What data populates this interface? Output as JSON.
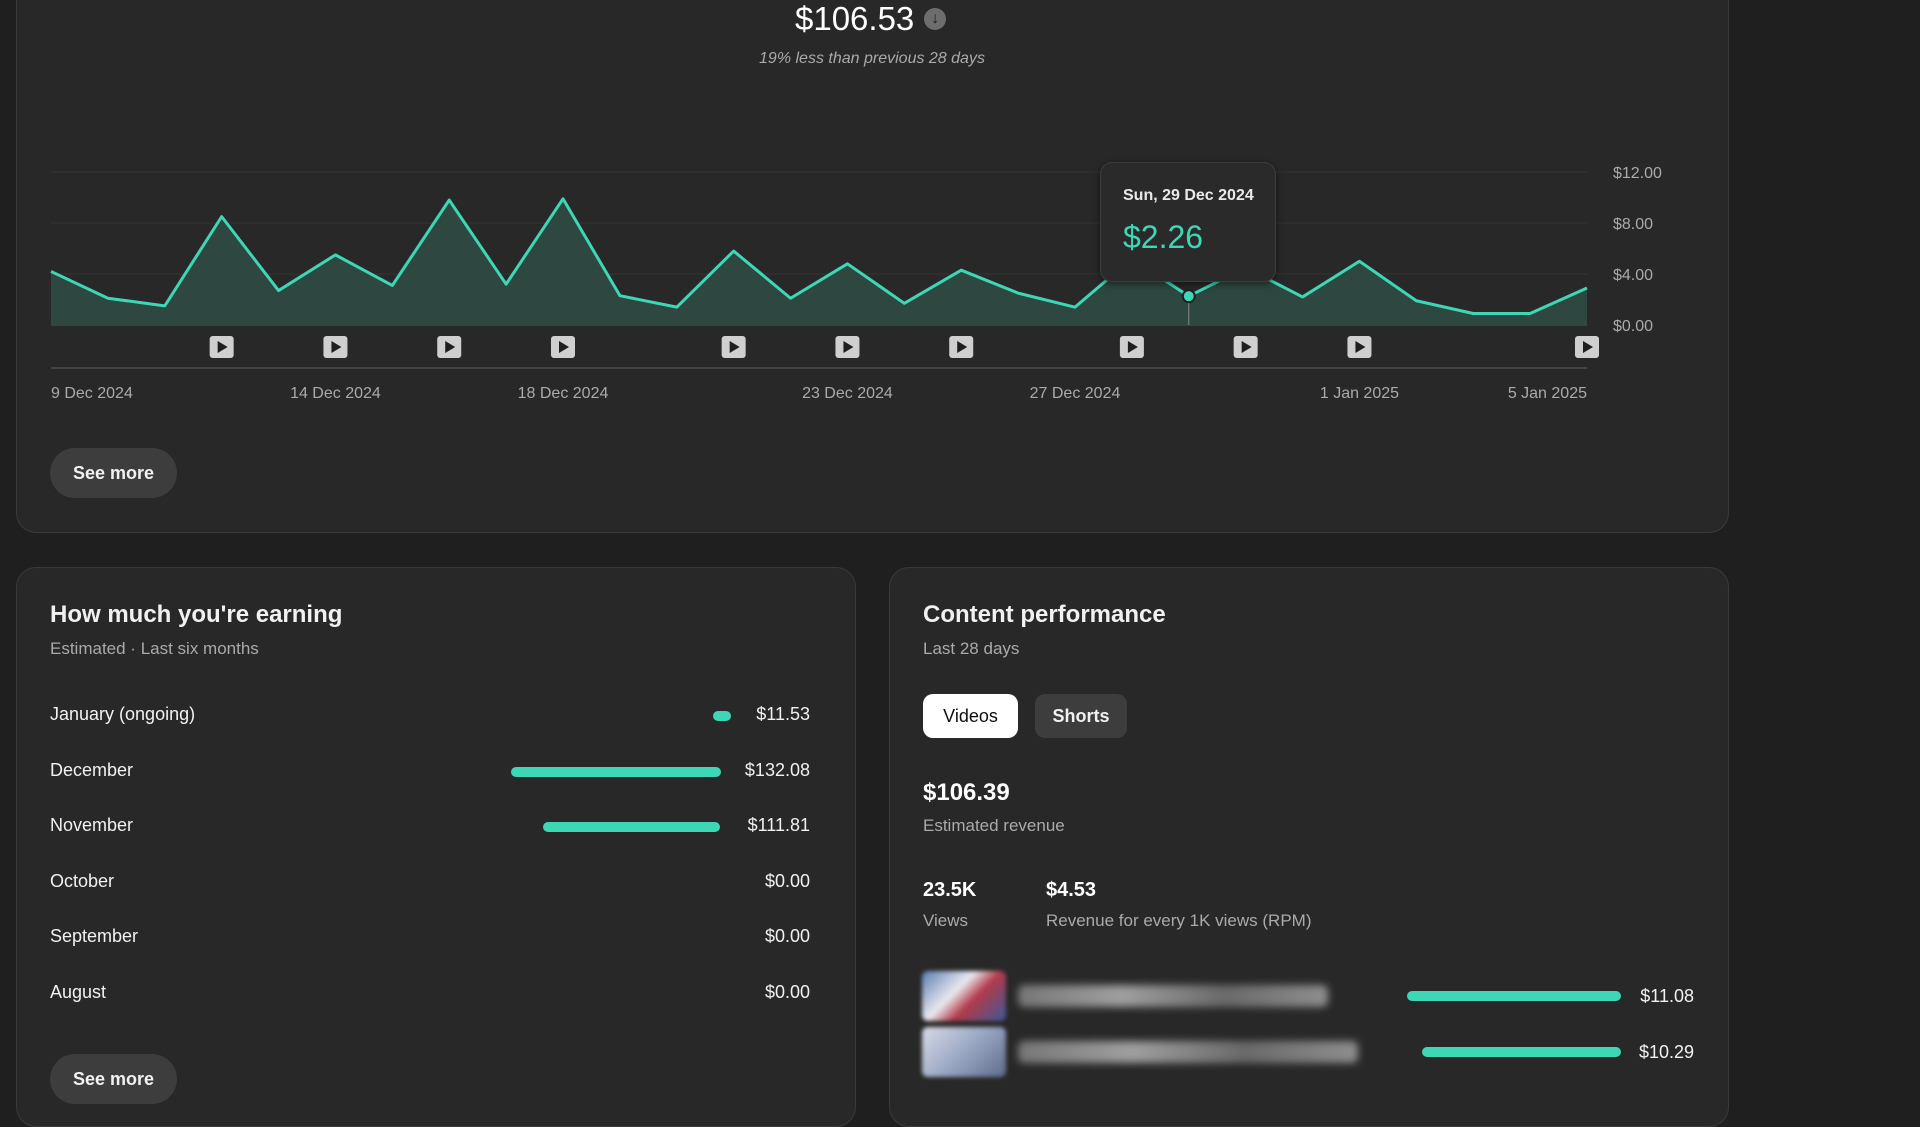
{
  "summary": {
    "total": "$106.53",
    "comparison": "19% less than previous 28 days",
    "see_more_label": "See more"
  },
  "chart_data": {
    "type": "area",
    "x": [
      "9 Dec 2024",
      "10 Dec 2024",
      "11 Dec 2024",
      "12 Dec 2024",
      "13 Dec 2024",
      "14 Dec 2024",
      "15 Dec 2024",
      "16 Dec 2024",
      "17 Dec 2024",
      "18 Dec 2024",
      "19 Dec 2024",
      "20 Dec 2024",
      "21 Dec 2024",
      "22 Dec 2024",
      "23 Dec 2024",
      "24 Dec 2024",
      "25 Dec 2024",
      "26 Dec 2024",
      "27 Dec 2024",
      "28 Dec 2024",
      "29 Dec 2024",
      "30 Dec 2024",
      "31 Dec 2024",
      "1 Jan 2025",
      "2 Jan 2025",
      "3 Jan 2025",
      "4 Jan 2025",
      "5 Jan 2025"
    ],
    "series": [
      {
        "values": [
          4.2,
          2.1,
          1.5,
          8.5,
          2.7,
          5.5,
          3.1,
          9.8,
          3.2,
          9.9,
          2.3,
          1.4,
          5.8,
          2.1,
          4.8,
          1.7,
          4.3,
          2.5,
          1.4,
          5.2,
          2.26,
          4.5,
          2.2,
          5.0,
          1.9,
          0.9,
          0.9,
          2.9
        ]
      }
    ],
    "title": "",
    "xlabel": "",
    "ylabel": "",
    "ylim": [
      0,
      12
    ],
    "yticks": [
      "$0.00",
      "$4.00",
      "$8.00",
      "$12.00"
    ],
    "xticks": [
      {
        "label": "9 Dec 2024",
        "index": 0
      },
      {
        "label": "14 Dec 2024",
        "index": 5
      },
      {
        "label": "18 Dec 2024",
        "index": 9
      },
      {
        "label": "23 Dec 2024",
        "index": 14
      },
      {
        "label": "27 Dec 2024",
        "index": 18
      },
      {
        "label": "1 Jan 2025",
        "index": 23
      },
      {
        "label": "5 Jan 2025",
        "index": 27
      }
    ],
    "video_markers": [
      3,
      5,
      7,
      9,
      12,
      14,
      16,
      19,
      21,
      23,
      27
    ],
    "grid": true,
    "color": "#3ed7b5",
    "tooltip": {
      "index": 20,
      "date": "Sun, 29 Dec 2024",
      "value": "$2.26"
    }
  },
  "earnings": {
    "title": "How much you're earning",
    "subtitle": "Estimated · Last six months",
    "rows": [
      {
        "month": "January (ongoing)",
        "value": "$11.53",
        "amount": 11.53
      },
      {
        "month": "December",
        "value": "$132.08",
        "amount": 132.08
      },
      {
        "month": "November",
        "value": "$111.81",
        "amount": 111.81
      },
      {
        "month": "October",
        "value": "$0.00",
        "amount": 0
      },
      {
        "month": "September",
        "value": "$0.00",
        "amount": 0
      },
      {
        "month": "August",
        "value": "$0.00",
        "amount": 0
      }
    ],
    "see_more_label": "See more"
  },
  "content": {
    "title": "Content performance",
    "subtitle": "Last 28 days",
    "tabs": [
      {
        "label": "Videos",
        "active": true
      },
      {
        "label": "Shorts",
        "active": false
      }
    ],
    "revenue": "$106.39",
    "revenue_label": "Estimated revenue",
    "views": "23.5K",
    "views_label": "Views",
    "rpm": "$4.53",
    "rpm_label": "Revenue for every 1K views (RPM)",
    "videos": [
      {
        "value": "$11.08",
        "amount": 11.08
      },
      {
        "value": "$10.29",
        "amount": 10.29
      }
    ]
  },
  "colors": {
    "accent": "#3ed7b5",
    "background": "#1f1f1f",
    "card": "#282828"
  }
}
